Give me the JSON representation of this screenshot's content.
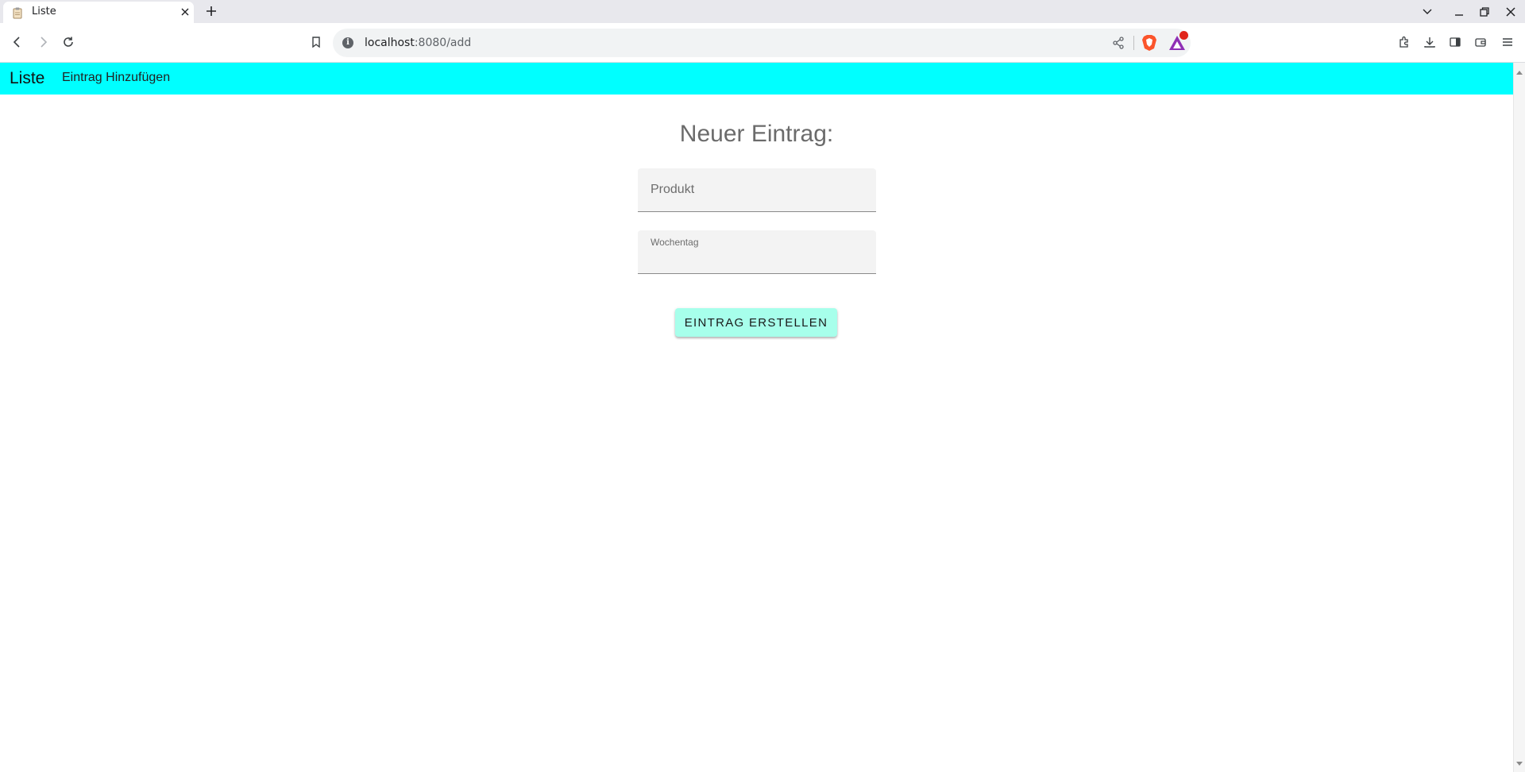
{
  "browser": {
    "tab": {
      "title": "Liste"
    },
    "address_bar": {
      "host": "localhost",
      "path": ":8080/add"
    }
  },
  "app": {
    "brand": "Liste",
    "nav": [
      {
        "label": "Eintrag Hinzufügen"
      }
    ]
  },
  "form": {
    "title": "Neuer Eintrag:",
    "fields": [
      {
        "label": "Produkt",
        "value": ""
      },
      {
        "label": "Wochentag",
        "value": ""
      }
    ],
    "submit_label": "EINTRAG ERSTELLEN"
  },
  "colors": {
    "app_bar": "#00ffff",
    "submit_button": "#a7ffeb",
    "field_background": "#f3f3f3"
  }
}
